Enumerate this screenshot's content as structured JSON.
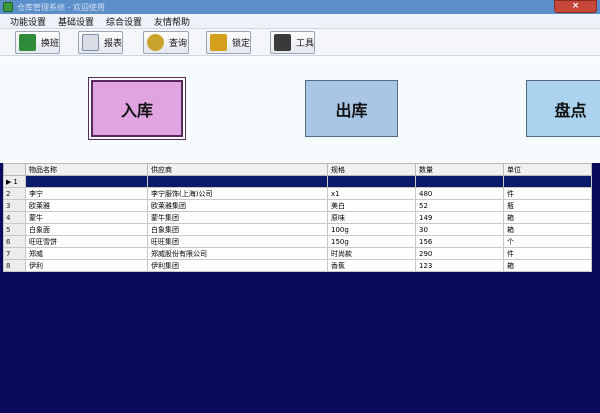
{
  "window": {
    "title": "仓库管理系统 - 欢迎使用",
    "close_glyph": "×"
  },
  "menu": [
    {
      "label": "功能设置"
    },
    {
      "label": "基础设置"
    },
    {
      "label": "综合设置"
    },
    {
      "label": "友情帮助"
    }
  ],
  "toolbar": [
    {
      "label": "换班",
      "icon": "user-switch-icon",
      "color": "#2f8a3a"
    },
    {
      "label": "报表",
      "icon": "report-icon",
      "color": "#7a8aa8"
    },
    {
      "label": "查询",
      "icon": "search-icon",
      "color": "#c9a42c"
    },
    {
      "label": "锁定",
      "icon": "lock-icon",
      "color": "#d4a01c"
    },
    {
      "label": "工具",
      "icon": "calculator-icon",
      "color": "#3a3a3a"
    }
  ],
  "actions": {
    "stock_in": "入库",
    "stock_out": "出库",
    "stock_check": "盘点"
  },
  "table": {
    "columns": [
      "物品名称",
      "供应商",
      "规格",
      "数量",
      "单位"
    ],
    "rows": [
      {
        "num": "1",
        "cells": [
          "",
          "",
          "",
          "",
          ""
        ],
        "current": true
      },
      {
        "num": "2",
        "cells": [
          "李宁",
          "李宁服饰(上海)公司",
          "x1",
          "480",
          "件"
        ]
      },
      {
        "num": "3",
        "cells": [
          "欧莱雅",
          "欧莱雅集团",
          "美白",
          "52",
          "瓶"
        ]
      },
      {
        "num": "4",
        "cells": [
          "蒙牛",
          "蒙牛集团",
          "原味",
          "149",
          "箱"
        ]
      },
      {
        "num": "5",
        "cells": [
          "白象面",
          "白象集团",
          "100g",
          "30",
          "箱"
        ]
      },
      {
        "num": "6",
        "cells": [
          "旺旺雪饼",
          "旺旺集团",
          "150g",
          "156",
          "个"
        ]
      },
      {
        "num": "7",
        "cells": [
          "郑威",
          "郑威股份有限公司",
          "时尚款",
          "290",
          "件"
        ]
      },
      {
        "num": "8",
        "cells": [
          "伊利",
          "伊利集团",
          "香蕉",
          "123",
          "箱"
        ]
      }
    ],
    "current_row_marker": "▶"
  }
}
